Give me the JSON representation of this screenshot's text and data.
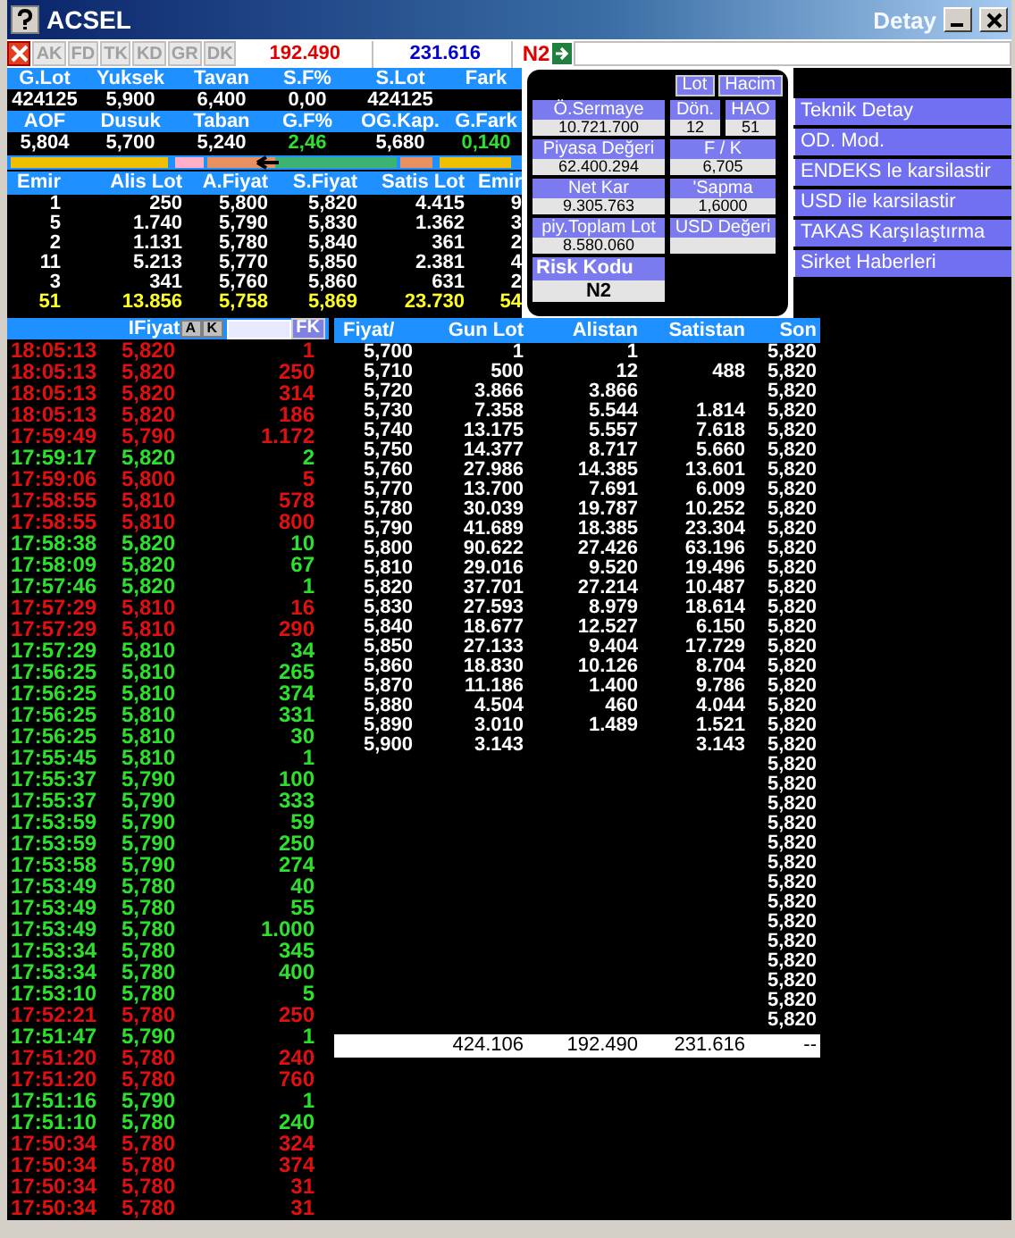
{
  "window": {
    "title": "ACSEL",
    "detail_label": "Detay"
  },
  "toolbar": {
    "buttons": [
      {
        "label": "AK",
        "disabled": true
      },
      {
        "label": "FD",
        "disabled": true
      },
      {
        "label": "TK",
        "disabled": true
      },
      {
        "label": "KD",
        "disabled": true
      },
      {
        "label": "GR",
        "disabled": true
      },
      {
        "label": "DK",
        "disabled": true
      }
    ],
    "buy_total": "192.490",
    "sell_total": "231.616",
    "risk": "N2"
  },
  "stats": [
    {
      "label": "G.Lot",
      "value": "424125",
      "kind": "plain"
    },
    {
      "label": "Yuksek",
      "value": "5,900",
      "kind": "plain"
    },
    {
      "label": "Tavan",
      "value": "6,400",
      "kind": "plain"
    },
    {
      "label": "S.F%",
      "value": "0,00",
      "kind": "plain"
    },
    {
      "label": "S.Lot",
      "value": "424125",
      "kind": "plain"
    },
    {
      "label": "Fark"
    },
    {
      "label": "AOF",
      "value": "5,804",
      "kind": "plain"
    },
    {
      "label": "Dusuk",
      "value": "5,700",
      "kind": "plain"
    },
    {
      "label": "Taban",
      "value": "5,240",
      "kind": "plain"
    },
    {
      "label": "G.F%",
      "value": "2,46",
      "kind": "up"
    },
    {
      "label": "OG.Kap.",
      "value": "5,680",
      "kind": "plain"
    },
    {
      "label": "G.Fark",
      "value": "0,140",
      "kind": "up"
    }
  ],
  "order_book": {
    "columns": [
      "Emir",
      "Alis Lot",
      "A.Fiyat",
      "S.Fiyat",
      "Satis Lot",
      "Emir"
    ],
    "rows": [
      [
        "1",
        "250",
        "5,800",
        "5,820",
        "4.415",
        "9"
      ],
      [
        "5",
        "1.740",
        "5,790",
        "5,830",
        "1.362",
        "3"
      ],
      [
        "2",
        "1.131",
        "5,780",
        "5,840",
        "361",
        "2"
      ],
      [
        "11",
        "5.213",
        "5,770",
        "5,850",
        "2.381",
        "4"
      ],
      [
        "3",
        "341",
        "5,760",
        "5,860",
        "631",
        "2"
      ]
    ],
    "totals": [
      "51",
      "13.856",
      "5,758",
      "5,869",
      "23.730",
      "54"
    ]
  },
  "detail": {
    "buttons": [
      "Lot",
      "Hacim"
    ],
    "fields": [
      {
        "label": "Ö.Sermaye",
        "value": "10.721.700"
      },
      {
        "label": "Dön.",
        "value": "12"
      },
      {
        "label": "HAO",
        "value": "51"
      },
      {
        "label": "Piyasa Değeri",
        "value": "62.400.294"
      },
      {
        "label": "F / K",
        "value": "6,705"
      },
      {
        "label": "Net Kar",
        "value": "9.305.763"
      },
      {
        "label": "'Sapma",
        "value": "1,6000"
      },
      {
        "label": "piy.Toplam Lot",
        "value": "8.580.060"
      },
      {
        "label": "USD Değeri"
      }
    ],
    "risk": {
      "label": "Risk Kodu",
      "value": "N2"
    }
  },
  "actions": [
    "Teknik Detay",
    "OD. Mod.",
    "ENDEKS le karsilastir",
    "USD ile karsilastir",
    "TAKAS Karşılaştırma",
    "Sirket Haberleri"
  ],
  "trades": {
    "header": "IFiyat",
    "buttons": [
      "A",
      "K"
    ],
    "filter_button": "FK",
    "rows": [
      {
        "time": "18:05:13",
        "price": "5,820",
        "lot": "1",
        "kind": "down"
      },
      {
        "time": "18:05:13",
        "price": "5,820",
        "lot": "250",
        "kind": "down"
      },
      {
        "time": "18:05:13",
        "price": "5,820",
        "lot": "314",
        "kind": "down"
      },
      {
        "time": "18:05:13",
        "price": "5,820",
        "lot": "186",
        "kind": "down"
      },
      {
        "time": "17:59:49",
        "price": "5,790",
        "lot": "1.172",
        "kind": "down"
      },
      {
        "time": "17:59:17",
        "price": "5,820",
        "lot": "2",
        "kind": "up"
      },
      {
        "time": "17:59:06",
        "price": "5,800",
        "lot": "5",
        "kind": "down"
      },
      {
        "time": "17:58:55",
        "price": "5,810",
        "lot": "578",
        "kind": "down"
      },
      {
        "time": "17:58:55",
        "price": "5,810",
        "lot": "800",
        "kind": "down"
      },
      {
        "time": "17:58:38",
        "price": "5,820",
        "lot": "10",
        "kind": "up"
      },
      {
        "time": "17:58:09",
        "price": "5,820",
        "lot": "67",
        "kind": "up"
      },
      {
        "time": "17:57:46",
        "price": "5,820",
        "lot": "1",
        "kind": "up"
      },
      {
        "time": "17:57:29",
        "price": "5,810",
        "lot": "16",
        "kind": "down"
      },
      {
        "time": "17:57:29",
        "price": "5,810",
        "lot": "290",
        "kind": "down"
      },
      {
        "time": "17:57:29",
        "price": "5,810",
        "lot": "34",
        "kind": "up"
      },
      {
        "time": "17:56:25",
        "price": "5,810",
        "lot": "265",
        "kind": "up"
      },
      {
        "time": "17:56:25",
        "price": "5,810",
        "lot": "374",
        "kind": "up"
      },
      {
        "time": "17:56:25",
        "price": "5,810",
        "lot": "331",
        "kind": "up"
      },
      {
        "time": "17:56:25",
        "price": "5,810",
        "lot": "30",
        "kind": "up"
      },
      {
        "time": "17:55:45",
        "price": "5,810",
        "lot": "1",
        "kind": "up"
      },
      {
        "time": "17:55:37",
        "price": "5,790",
        "lot": "100",
        "kind": "up"
      },
      {
        "time": "17:55:37",
        "price": "5,790",
        "lot": "333",
        "kind": "up"
      },
      {
        "time": "17:53:59",
        "price": "5,790",
        "lot": "59",
        "kind": "up"
      },
      {
        "time": "17:53:59",
        "price": "5,790",
        "lot": "250",
        "kind": "up"
      },
      {
        "time": "17:53:58",
        "price": "5,790",
        "lot": "274",
        "kind": "up"
      },
      {
        "time": "17:53:49",
        "price": "5,780",
        "lot": "40",
        "kind": "up"
      },
      {
        "time": "17:53:49",
        "price": "5,780",
        "lot": "55",
        "kind": "up"
      },
      {
        "time": "17:53:49",
        "price": "5,780",
        "lot": "1.000",
        "kind": "up"
      },
      {
        "time": "17:53:34",
        "price": "5,780",
        "lot": "345",
        "kind": "up"
      },
      {
        "time": "17:53:34",
        "price": "5,780",
        "lot": "400",
        "kind": "up"
      },
      {
        "time": "17:53:10",
        "price": "5,780",
        "lot": "5",
        "kind": "up"
      },
      {
        "time": "17:52:21",
        "price": "5,780",
        "lot": "250",
        "kind": "down"
      },
      {
        "time": "17:51:47",
        "price": "5,790",
        "lot": "1",
        "kind": "up"
      },
      {
        "time": "17:51:20",
        "price": "5,780",
        "lot": "240",
        "kind": "down"
      },
      {
        "time": "17:51:20",
        "price": "5,780",
        "lot": "760",
        "kind": "down"
      },
      {
        "time": "17:51:16",
        "price": "5,790",
        "lot": "1",
        "kind": "up"
      },
      {
        "time": "17:51:10",
        "price": "5,780",
        "lot": "240",
        "kind": "up"
      },
      {
        "time": "17:50:34",
        "price": "5,780",
        "lot": "324",
        "kind": "down"
      },
      {
        "time": "17:50:34",
        "price": "5,780",
        "lot": "374",
        "kind": "down"
      },
      {
        "time": "17:50:34",
        "price": "5,780",
        "lot": "31",
        "kind": "down"
      },
      {
        "time": "17:50:34",
        "price": "5,780",
        "lot": "31",
        "kind": "down"
      }
    ]
  },
  "price_table": {
    "columns": [
      "Fiyat/",
      "Gun Lot",
      "Alistan",
      "Satistan",
      "Son"
    ],
    "rows": [
      {
        "price": "5,700",
        "gun_lot": "1",
        "alistan": "1",
        "son": "5,820"
      },
      {
        "price": "5,710",
        "gun_lot": "500",
        "alistan": "12",
        "satistan": "488",
        "son": "5,820"
      },
      {
        "price": "5,720",
        "gun_lot": "3.866",
        "alistan": "3.866",
        "son": "5,820"
      },
      {
        "price": "5,730",
        "gun_lot": "7.358",
        "alistan": "5.544",
        "satistan": "1.814",
        "son": "5,820"
      },
      {
        "price": "5,740",
        "gun_lot": "13.175",
        "alistan": "5.557",
        "satistan": "7.618",
        "son": "5,820"
      },
      {
        "price": "5,750",
        "gun_lot": "14.377",
        "alistan": "8.717",
        "satistan": "5.660",
        "son": "5,820"
      },
      {
        "price": "5,760",
        "gun_lot": "27.986",
        "alistan": "14.385",
        "satistan": "13.601",
        "son": "5,820"
      },
      {
        "price": "5,770",
        "gun_lot": "13.700",
        "alistan": "7.691",
        "satistan": "6.009",
        "son": "5,820"
      },
      {
        "price": "5,780",
        "gun_lot": "30.039",
        "alistan": "19.787",
        "satistan": "10.252",
        "son": "5,820"
      },
      {
        "price": "5,790",
        "gun_lot": "41.689",
        "alistan": "18.385",
        "satistan": "23.304",
        "son": "5,820"
      },
      {
        "price": "5,800",
        "gun_lot": "90.622",
        "alistan": "27.426",
        "satistan": "63.196",
        "son": "5,820"
      },
      {
        "price": "5,810",
        "gun_lot": "29.016",
        "alistan": "9.520",
        "satistan": "19.496",
        "son": "5,820"
      },
      {
        "price": "5,820",
        "gun_lot": "37.701",
        "alistan": "27.214",
        "satistan": "10.487",
        "son": "5,820"
      },
      {
        "price": "5,830",
        "gun_lot": "27.593",
        "alistan": "8.979",
        "satistan": "18.614",
        "son": "5,820"
      },
      {
        "price": "5,840",
        "gun_lot": "18.677",
        "alistan": "12.527",
        "satistan": "6.150",
        "son": "5,820"
      },
      {
        "price": "5,850",
        "gun_lot": "27.133",
        "alistan": "9.404",
        "satistan": "17.729",
        "son": "5,820"
      },
      {
        "price": "5,860",
        "gun_lot": "18.830",
        "alistan": "10.126",
        "satistan": "8.704",
        "son": "5,820"
      },
      {
        "price": "5,870",
        "gun_lot": "11.186",
        "alistan": "1.400",
        "satistan": "9.786",
        "son": "5,820"
      },
      {
        "price": "5,880",
        "gun_lot": "4.504",
        "alistan": "460",
        "satistan": "4.044",
        "son": "5,820"
      },
      {
        "price": "5,890",
        "gun_lot": "3.010",
        "alistan": "1.489",
        "satistan": "1.521",
        "son": "5,820"
      },
      {
        "price": "5,900",
        "gun_lot": "3.143",
        "satistan": "3.143",
        "son": "5,820"
      },
      {
        "son": "5,820"
      },
      {
        "son": "5,820"
      },
      {
        "son": "5,820"
      },
      {
        "son": "5,820"
      },
      {
        "son": "5,820"
      },
      {
        "son": "5,820"
      },
      {
        "son": "5,820"
      },
      {
        "son": "5,820"
      },
      {
        "son": "5,820"
      },
      {
        "son": "5,820"
      },
      {
        "son": "5,820"
      },
      {
        "son": "5,820"
      },
      {
        "son": "5,820"
      },
      {
        "son": "5,820"
      }
    ],
    "totals": [
      "424.106",
      "192.490",
      "231.616",
      "--"
    ]
  }
}
